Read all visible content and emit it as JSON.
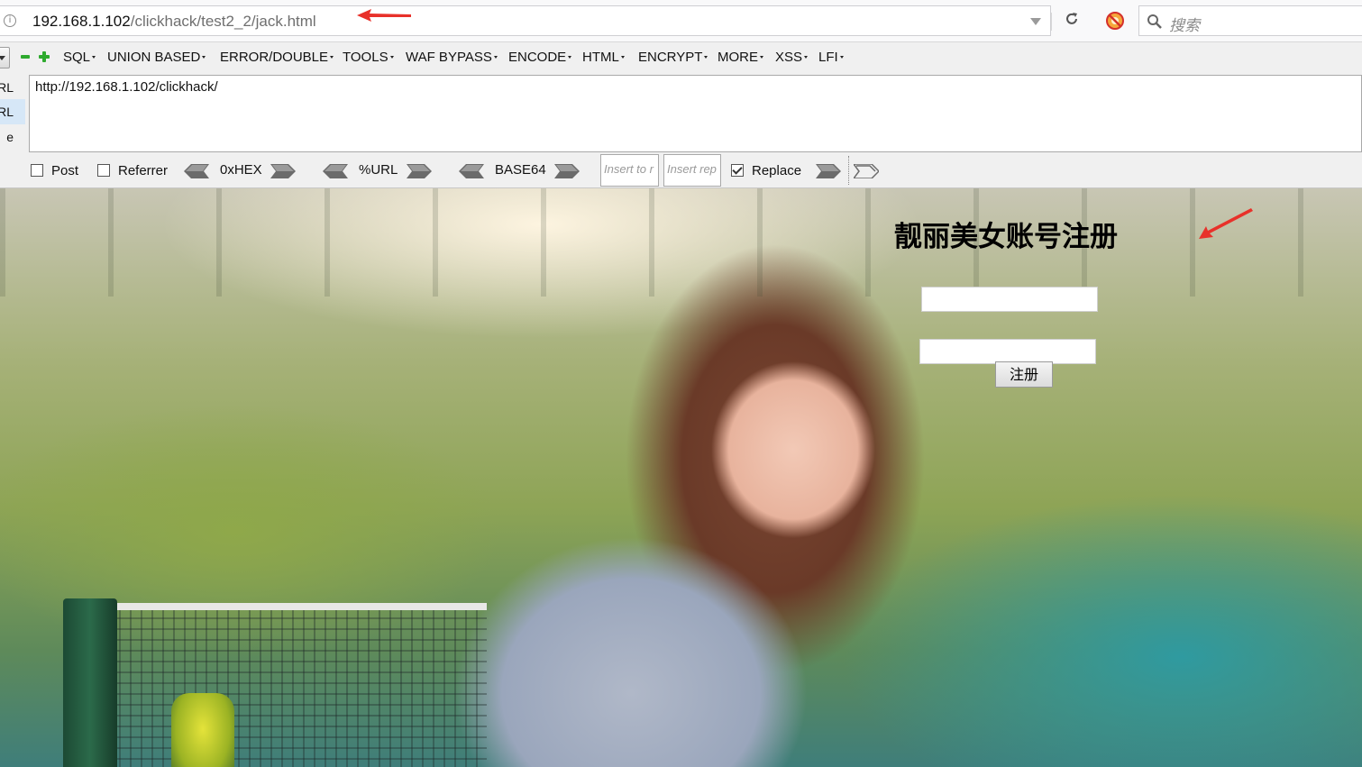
{
  "browser": {
    "url_host": "192.168.1.102",
    "url_path": "/clickhack/test2_2/jack.html",
    "search_placeholder": "搜索"
  },
  "hackbar": {
    "menu": [
      "SQL",
      "UNION BASED",
      "ERROR/DOUBLE",
      "TOOLS",
      "WAF BYPASS",
      "ENCODE",
      "HTML",
      "ENCRYPT",
      "MORE",
      "XSS",
      "LFI"
    ],
    "side_tabs": [
      "RL",
      "RL",
      "e"
    ],
    "url_value": "http://192.168.1.102/clickhack/",
    "options": {
      "post_label": "Post",
      "post_checked": false,
      "referrer_label": "Referrer",
      "referrer_checked": false,
      "hex_label": "0xHEX",
      "urlenc_label": "%URL",
      "base64_label": "BASE64",
      "insert_to_placeholder": "Insert to r",
      "insert_replace_placeholder": "Insert rep",
      "replace_label": "Replace",
      "replace_checked": true
    }
  },
  "page": {
    "title": "靓丽美女账号注册",
    "submit_label": "注册"
  },
  "colors": {
    "annotation_arrow": "#e8312a",
    "minus_plus_icons": "#2eaa2e"
  }
}
